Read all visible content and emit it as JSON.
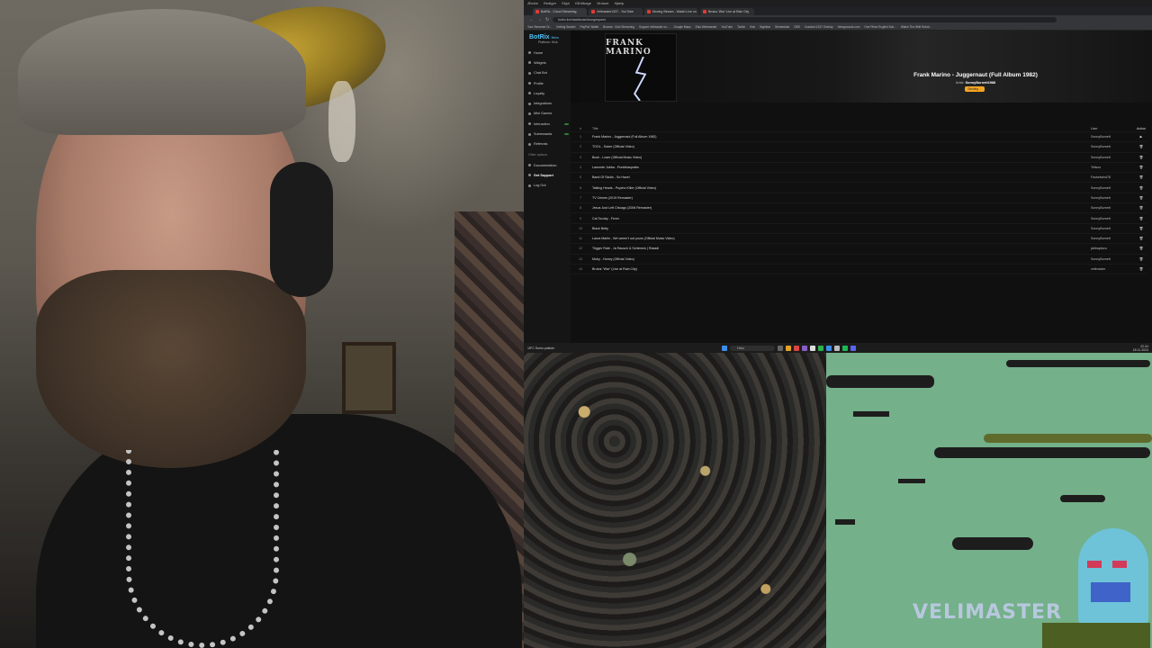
{
  "os_menu": [
    "Ændre",
    "Rediger",
    "Skjul",
    "Gå tilbage",
    "Vinduer",
    "Hjælp"
  ],
  "tabs": [
    {
      "label": "BotRix - Cloud Streaming",
      "active": true
    },
    {
      "label": "Velimaster1337 - YouTube",
      "active": false
    },
    {
      "label": "Moving Stream - Watch Live on",
      "active": false
    },
    {
      "label": "Brutus 'War' Live at Rain City",
      "active": false
    }
  ],
  "url": "botrix.live/dashboard/songrequest",
  "bookmarks": [
    "Your Streamer Di...",
    "Getting Started",
    "PayPal: Wallet",
    "Browse - Kick Streaming",
    "Support velimaster on...",
    "Google Maps",
    "Elsa Wishmaster",
    "YouTube",
    "Twitch",
    "Kick",
    "Nightbot",
    "Streamlabs",
    "OBS",
    "Cracked.1337 Overlay",
    "Newgrounds.com",
    "One Piece English Sub...",
    "Watch The Wild Robot..."
  ],
  "sidebar": {
    "logo": "BotRix",
    "logo_sub": "Beta",
    "platform": "Platform: Kick",
    "items": [
      {
        "label": "Home",
        "pill": false
      },
      {
        "label": "Widgets",
        "pill": false
      },
      {
        "label": "Chat Bot",
        "pill": false
      },
      {
        "label": "Profile",
        "pill": false
      },
      {
        "label": "Loyalty",
        "pill": false
      },
      {
        "label": "Integrations",
        "pill": false
      },
      {
        "label": "Mini Games",
        "pill": false
      },
      {
        "label": "Interaction",
        "pill": true
      },
      {
        "label": "Subrewards",
        "pill": true
      },
      {
        "label": "Referrals",
        "pill": false
      }
    ],
    "other_label": "Other options",
    "other_items": [
      {
        "label": "Documentation"
      },
      {
        "label": "Get Support"
      },
      {
        "label": "Log Out"
      }
    ]
  },
  "now_playing": {
    "cover_title": "FRANK MARINO",
    "title": "Frank Marino - Juggernaut (Full Album 1982)",
    "artist_label": "Artist:",
    "artist": "SonnyBurnett1988",
    "badge": "Sending ..."
  },
  "table": {
    "headers": {
      "num": "#",
      "title": "Title",
      "user": "User",
      "action": "Action"
    },
    "rows": [
      {
        "num": "1",
        "title": "Frank Marino - Juggernaut (Full Album 1982)",
        "user": "SonnyBurnett",
        "action": "▶"
      },
      {
        "num": "2",
        "title": "TOOL - Sober (Official Video)",
        "user": "SonnyBurnett",
        "action": "🗑"
      },
      {
        "num": "3",
        "title": "Bush - Loser (Official Music Video)",
        "user": "SonnyBurnett",
        "action": "🗑"
      },
      {
        "num": "4",
        "title": "Lamonte Jubba - Punkthasprabs",
        "user": "Teilsoo",
        "action": "🗑"
      },
      {
        "num": "5",
        "title": "Band Of Skulls - So Hazel",
        "user": "Fackelwind78",
        "action": "🗑"
      },
      {
        "num": "6",
        "title": "Talking Heads - Psycho Killer (Official Video)",
        "user": "SonnyBurnett",
        "action": "🗑"
      },
      {
        "num": "7",
        "title": "TV Crimes (2019 Remaster)",
        "user": "SonnyBurnett",
        "action": "🗑"
      },
      {
        "num": "8",
        "title": "Jesus Just Left Chicago (2006 Remaster)",
        "user": "SonnyBurnett",
        "action": "🗑"
      },
      {
        "num": "9",
        "title": "Cal Scruby - Fever",
        "user": "SonnyBurnett",
        "action": "🗑"
      },
      {
        "num": "10",
        "title": "Black Betty",
        "user": "SonnyBurnett",
        "action": "🗑"
      },
      {
        "num": "11",
        "title": "Laura Marlin - We weren't out yours (Official Music Video)",
        "user": "SonnyBurnett",
        "action": "🗑"
      },
      {
        "num": "12",
        "title": "Trigger Rate - Ja Rausch & Schimeck | Rasadi",
        "user": "jabbayksvu",
        "action": "🗑"
      },
      {
        "num": "13",
        "title": "Moby - Honey (Official Video)",
        "user": "SonnyBurnett",
        "action": "🗑"
      },
      {
        "num": "14",
        "title": "Brutus \"War\" (Live at Rain City)",
        "user": "velimaster",
        "action": "🗑"
      }
    ]
  },
  "taskbar": {
    "weather": "18°C Sumu paikoin",
    "search": "Haku",
    "time": "22.04",
    "date": "18.11.2024"
  },
  "game": {
    "logo": "VELIMASTER"
  },
  "colors": {
    "accent": "#4fc3f7",
    "badge": "#f6a623",
    "game_bg": "#74b08a"
  }
}
